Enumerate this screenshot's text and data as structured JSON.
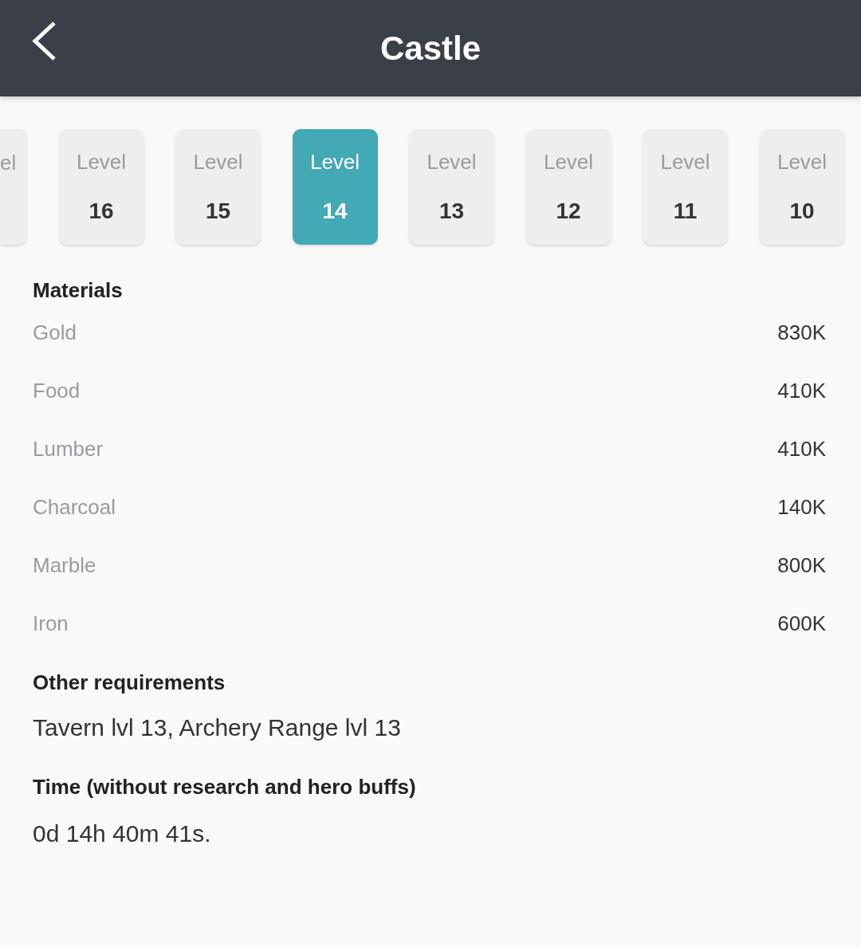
{
  "header": {
    "title": "Castle"
  },
  "levels": [
    {
      "kind": "clipped",
      "label": "el",
      "selected": false
    },
    {
      "kind": "full",
      "label": "Level",
      "number": "16",
      "selected": false
    },
    {
      "kind": "full",
      "label": "Level",
      "number": "15",
      "selected": false
    },
    {
      "kind": "full",
      "label": "Level",
      "number": "14",
      "selected": true
    },
    {
      "kind": "full",
      "label": "Level",
      "number": "13",
      "selected": false
    },
    {
      "kind": "full",
      "label": "Level",
      "number": "12",
      "selected": false
    },
    {
      "kind": "full",
      "label": "Level",
      "number": "11",
      "selected": false
    },
    {
      "kind": "full",
      "label": "Level",
      "number": "10",
      "selected": false
    }
  ],
  "materials": {
    "title": "Materials",
    "items": [
      {
        "name": "Gold",
        "amount": "830K"
      },
      {
        "name": "Food",
        "amount": "410K"
      },
      {
        "name": "Lumber",
        "amount": "410K"
      },
      {
        "name": "Charcoal",
        "amount": "140K"
      },
      {
        "name": "Marble",
        "amount": "800K"
      },
      {
        "name": "Iron",
        "amount": "600K"
      }
    ]
  },
  "other_requirements": {
    "title": "Other requirements",
    "text": "Tavern lvl 13, Archery Range lvl 13"
  },
  "time": {
    "title": "Time (without research and hero buffs)",
    "text": "0d 14h 40m 41s."
  }
}
